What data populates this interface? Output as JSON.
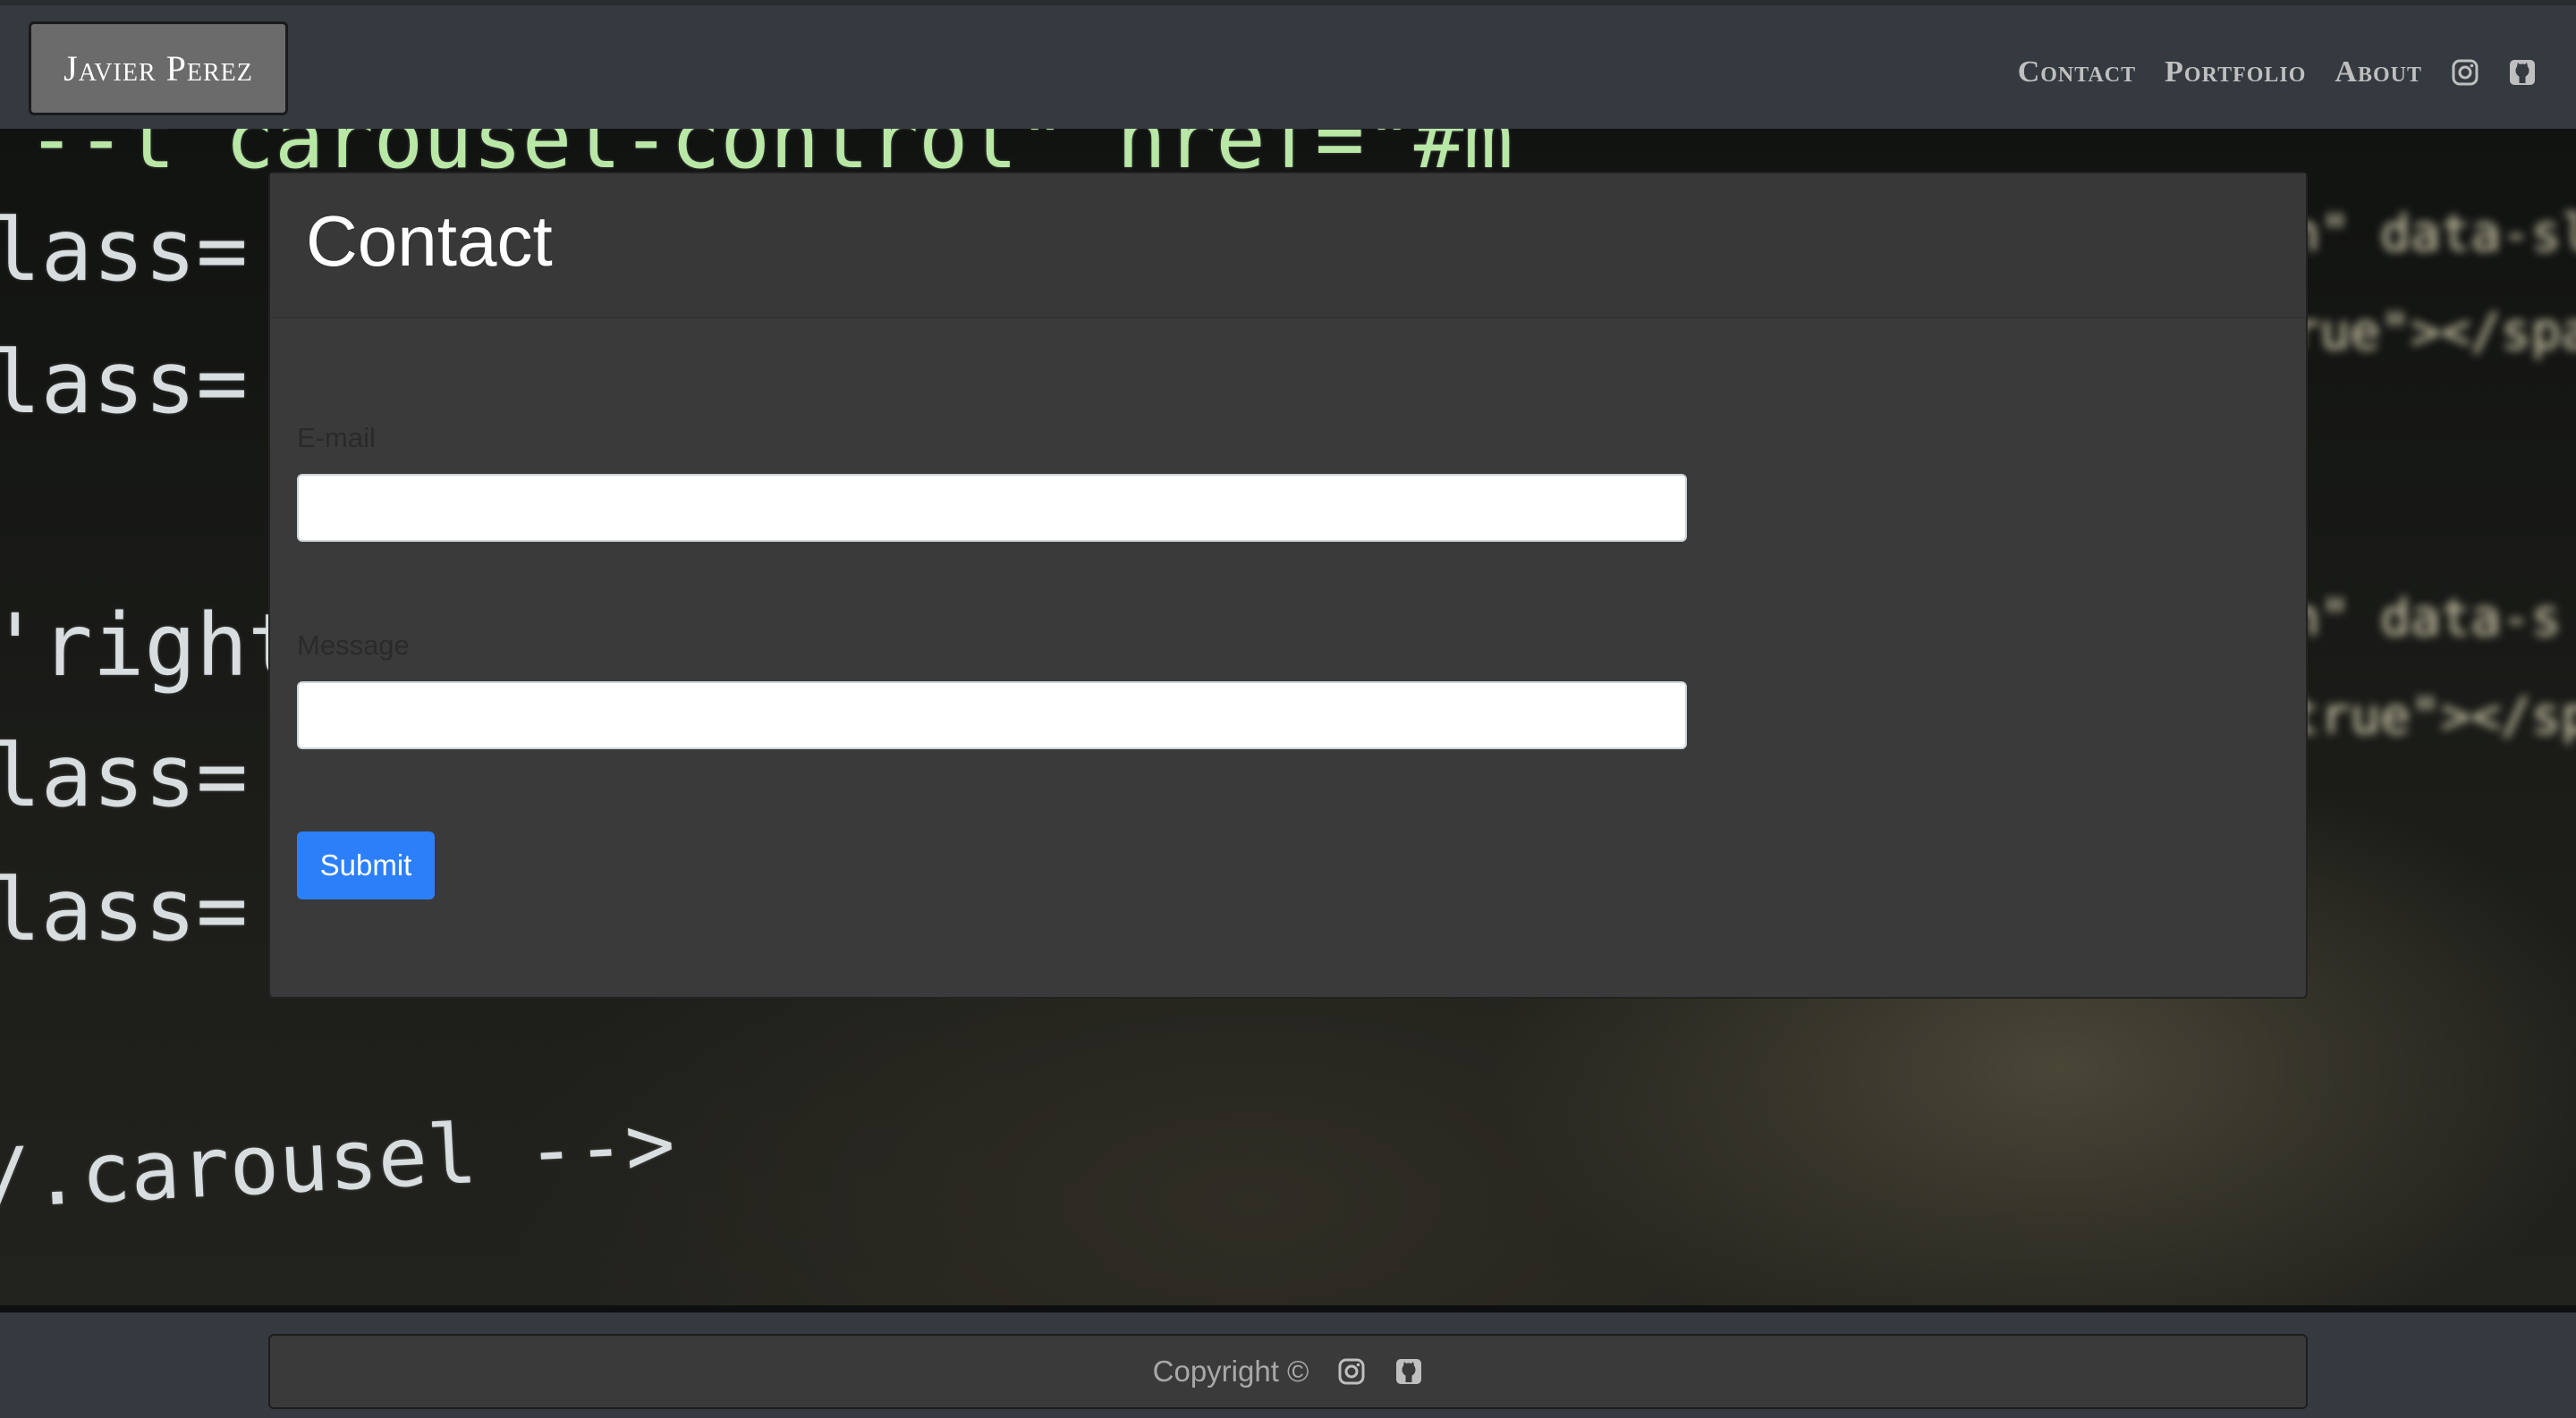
{
  "brand": {
    "name": "Javier Perez"
  },
  "nav": {
    "links": [
      {
        "label": "Contact"
      },
      {
        "label": "Portfolio"
      },
      {
        "label": "About"
      }
    ],
    "icons": [
      "instagram-icon",
      "github-icon"
    ]
  },
  "background": {
    "code_lines": [
      "--t carousel-control\" href=\"#m",
      "lass=",
      "lass=",
      "'right",
      "lass=",
      "lass=",
      "/.carousel -->"
    ],
    "blurred_right": [
      "n\" data-sl",
      "rue\"></spa",
      "n\" data-s",
      "true\"></sp"
    ]
  },
  "contact": {
    "title": "Contact",
    "email_label": "E-mail",
    "email_value": "",
    "message_label": "Message",
    "message_value": "",
    "submit_label": "Submit"
  },
  "footer": {
    "copyright": "Copyright ©",
    "icons": [
      "instagram-icon",
      "github-icon"
    ]
  },
  "colors": {
    "navbar": "#343a40",
    "card": "#3a3a3a",
    "primary_button": "#2d7ff9"
  }
}
